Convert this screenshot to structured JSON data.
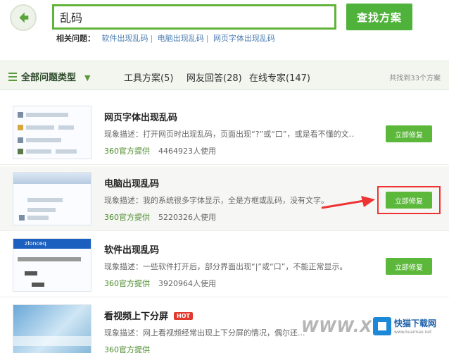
{
  "search": {
    "value": "乱码",
    "button_label": "查找方案"
  },
  "related": {
    "label": "相关问题：",
    "items": [
      "软件出现乱码",
      "电脑出现乱码",
      "网页字体出现乱码"
    ]
  },
  "filter": {
    "all_label": "全部问题类型",
    "tabs": [
      "工具方案(5)",
      "网友回答(28)",
      "在线专家(147)"
    ],
    "count_text": "共找到33个方案"
  },
  "results": [
    {
      "title": "网页字体出现乱码",
      "desc": "现象描述：打开网页时出现乱码，页面出现“?”或“口”，或是看不懂的文...",
      "source": "360官方提供",
      "usage": "4464923人使用",
      "button": "立即修复",
      "hot": ""
    },
    {
      "title": "电脑出现乱码",
      "desc": "现象描述：我的系统很多字体显示，全是方框或乱码，没有文字。",
      "source": "360官方提供",
      "usage": "5220326人使用",
      "button": "立即修复",
      "hot": ""
    },
    {
      "title": "软件出现乱码",
      "desc": "现象描述：一些软件打开后，部分界面出现“|”或“口”，不能正常显示。",
      "source": "360官方提供",
      "usage": "3920964人使用",
      "button": "立即修复",
      "hot": ""
    },
    {
      "title": "看视频上下分屏",
      "desc": "现象描述：网上看视频经常出现上下分屏的情况，偶尔还...",
      "source": "360官方提供",
      "usage": "",
      "button": "",
      "hot": "HOT"
    }
  ],
  "thumb_texts": {
    "row3_title": "zlonceq"
  },
  "watermark": {
    "text": "WWW.XFD",
    "logo_name": "快猫下载网",
    "logo_url": "www.kuaimao.net"
  },
  "colors": {
    "accent": "#4fb23a",
    "link": "#4a7cb0",
    "highlight": "#e33333"
  }
}
